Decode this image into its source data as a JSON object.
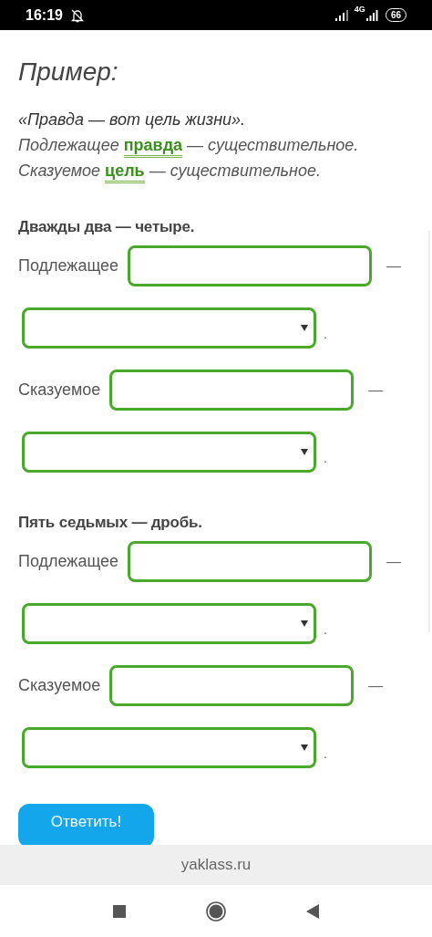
{
  "status_bar": {
    "time": "16:19",
    "battery": "66",
    "network": "4G"
  },
  "example": {
    "title": "Пример:",
    "quote": "«Правда — вот цель жизни».",
    "lines": [
      [
        {
          "text": "Подлежащее "
        },
        {
          "text": "правда",
          "kind": "answer"
        },
        {
          "text": " — существительное."
        }
      ],
      [
        {
          "text": "Сказуемое "
        },
        {
          "text": "цель",
          "kind": "answer"
        },
        {
          "text": " — существительное."
        }
      ]
    ]
  },
  "tasks": [
    {
      "sentence": "Дважды два — четыре.",
      "rows": [
        {
          "label": "Подлежащее",
          "dash": "—",
          "period": "."
        },
        {
          "label": "Сказуемое",
          "dash": "—",
          "period": "."
        }
      ]
    },
    {
      "sentence": "Пять седьмых — дробь.",
      "rows": [
        {
          "label": "Подлежащее",
          "dash": "—",
          "period": "."
        },
        {
          "label": "Сказуемое",
          "dash": "—",
          "period": "."
        }
      ]
    }
  ],
  "submit_button": "Ответить!",
  "url_bar": "yaklass.ru"
}
